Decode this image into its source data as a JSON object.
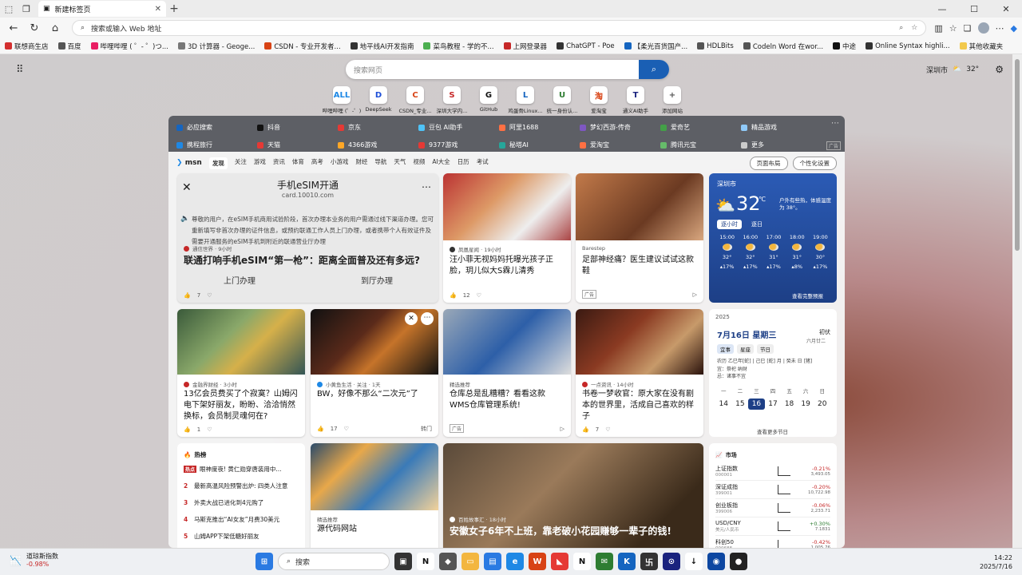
{
  "browser": {
    "tab_title": "新建标签页",
    "address_placeholder": "搜索或输入 Web 地址",
    "bookmarks": [
      {
        "label": "联想商生店",
        "color": "#d32f2f"
      },
      {
        "label": "百度",
        "color": "#555"
      },
      {
        "label": "哔哩哔哩 ( ゜- ゜)つ...",
        "color": "#e91e63"
      },
      {
        "label": "3D 计算器 - Geoge...",
        "color": "#777"
      },
      {
        "label": "CSDN - 专业开发者...",
        "color": "#d84315"
      },
      {
        "label": "地平线AI开发指南",
        "color": "#333"
      },
      {
        "label": "菜鸟教程 - 学的不...",
        "color": "#4caf50"
      },
      {
        "label": "上网登录器",
        "color": "#c62828"
      },
      {
        "label": "ChatGPT - Poe",
        "color": "#333"
      },
      {
        "label": "【柔光百货国产...",
        "color": "#1565c0"
      },
      {
        "label": "HDLBits",
        "color": "#555"
      },
      {
        "label": "Codeln Word 在wor...",
        "color": "#555"
      },
      {
        "label": "中途",
        "color": "#111"
      },
      {
        "label": "Online Syntax highli...",
        "color": "#333"
      },
      {
        "label": "其他收藏夹",
        "color": "#f2c94c"
      }
    ]
  },
  "newtab": {
    "search_placeholder": "搜索网页",
    "weather_city": "深圳市",
    "weather_temp": "32°",
    "quick_links": [
      {
        "label": "哔哩哔哩 (゜-゜)",
        "icon": "ALL",
        "color": "#1e88e5"
      },
      {
        "label": "DeepSeek",
        "icon": "D",
        "color": "#1e4fd8"
      },
      {
        "label": "CSDN_专业...",
        "icon": "C",
        "color": "#d84315"
      },
      {
        "label": "深圳大学内...",
        "icon": "S",
        "color": "#c62828"
      },
      {
        "label": "GitHub",
        "icon": "G",
        "color": "#111"
      },
      {
        "label": "鸡蛋骨Linux...",
        "icon": "L",
        "color": "#1565c0"
      },
      {
        "label": "统一身份认...",
        "icon": "U",
        "color": "#2e7d32"
      },
      {
        "label": "爱淘宝",
        "icon": "淘",
        "color": "#d84315"
      },
      {
        "label": "通义AI助手",
        "icon": "T",
        "color": "#1a237e"
      },
      {
        "label": "添加网站",
        "icon": "+",
        "color": "#555"
      }
    ],
    "top_links": [
      {
        "label": "必应搜索",
        "color": "#1565c0"
      },
      {
        "label": "抖音",
        "color": "#111"
      },
      {
        "label": "京东",
        "color": "#e53935"
      },
      {
        "label": "豆包 AI助手",
        "color": "#4fc3f7"
      },
      {
        "label": "阿里1688",
        "color": "#ff7043"
      },
      {
        "label": "梦幻西游-传奇",
        "color": "#7e57c2"
      },
      {
        "label": "爱奇艺",
        "color": "#43a047"
      },
      {
        "label": "精品游戏",
        "color": "#90caf9"
      },
      {
        "label": "携程旅行",
        "color": "#1e88e5"
      },
      {
        "label": "天猫",
        "color": "#e53935"
      },
      {
        "label": "4366游戏",
        "color": "#ffa726"
      },
      {
        "label": "9377游戏",
        "color": "#e53935"
      },
      {
        "label": "秘塔AI",
        "color": "#26a69a"
      },
      {
        "label": "爱淘宝",
        "color": "#ff7043"
      },
      {
        "label": "腾讯元宝",
        "color": "#66bb6a"
      },
      {
        "label": "更多",
        "color": "#ccc"
      }
    ],
    "ad_label": "广告",
    "msn": {
      "logo": "msn",
      "tabs": [
        "发现",
        "关注",
        "游戏",
        "资讯",
        "体育",
        "高考",
        "小游戏",
        "财经",
        "导航",
        "天气",
        "视频",
        "AI大全",
        "日历",
        "考试"
      ],
      "layout_btn": "页面布局",
      "personalize_btn": "个性化设置"
    },
    "cards": {
      "esim": {
        "title": "手机eSIM开通",
        "host": "card.10010.com",
        "body": "尊敬的用户，在eSIM手机商用试验阶段，首次办理本业务的用户需通过线下渠道办理。您可重新填写非首次办理的证件信息，或预约联通工作人员上门办理，或者携带个人有效证件及需要开通服务的eSIM手机到附近的联通营业厅办理",
        "btn1": "上门办理",
        "btn2": "到厅办理",
        "source": "通信世界 · 9小时",
        "headline": "联通打响手机eSIM“第一枪”：距离全面普及还有多远?",
        "likes": "7"
      },
      "c2": {
        "source": "凤凰星闻 · 19小时",
        "headline": "汪小菲无视妈妈托曝光孩子正脸，玥儿似大S霖儿清秀",
        "likes": "12"
      },
      "c3": {
        "source": "Barestep",
        "headline": "足部神经痛？医生建议试试这款鞋",
        "ad": "广告"
      },
      "c4": {
        "source": "金融界财经 · 3小时",
        "headline": "13亿会员费买了个寂寞？山姆闪电下架好丽友，盼盼、洽洽悄然换标，会员制灵魂何在?",
        "likes": "1"
      },
      "c5": {
        "source": "小黄鱼生活 · 关注 · 1天",
        "headline": "BW，好像不那么“二次元”了",
        "likes": "17",
        "share": "转门"
      },
      "c6": {
        "source": "精选推荐",
        "headline": "仓库总是乱糟糟？看看这款WMS仓库管理系统!",
        "ad": "广告"
      },
      "c7": {
        "source": "一点资讯 · 14小时",
        "headline": "书卷一梦收官：原大家在没有剧本的世界里，活成自己喜欢的样子",
        "likes": "7"
      },
      "c8": {
        "source": "精选推荐",
        "headline": "源代码网站"
      },
      "c9": {
        "source": "百姓故事汇 · 18小时",
        "headline": "安徽女子6年不上班，靠老破小花园赚够一辈子的钱!"
      }
    },
    "weather": {
      "city": "深圳市",
      "temp": "32",
      "unit": "℃",
      "desc": "户外有些热，体感温度为 38°。",
      "tab_hourly": "逐小时",
      "tab_daily": "逐日",
      "hours": [
        {
          "t": "15:00",
          "temp": "32°",
          "rain": "17%"
        },
        {
          "t": "16:00",
          "temp": "32°",
          "rain": "17%"
        },
        {
          "t": "17:00",
          "temp": "31°",
          "rain": "17%"
        },
        {
          "t": "18:00",
          "temp": "31°",
          "rain": "8%"
        },
        {
          "t": "19:00",
          "temp": "30°",
          "rain": "17%"
        }
      ],
      "more": "查看完整预报"
    },
    "calendar": {
      "year": "2025",
      "date": "7月16日 星期三",
      "lunar": "初伏",
      "lunar2": "六月廿二",
      "tabs": [
        "宜事",
        "星座",
        "节日"
      ],
      "yi": "农历 乙巳年[蛇] | 己巳 [蛇] 月 | 癸未 日 [猪]",
      "todo": "宜：祭祀 纳财",
      "avoid": "忌：诸事不宜",
      "weekdays": [
        "一",
        "二",
        "三",
        "四",
        "五",
        "六",
        "日"
      ],
      "dates": [
        "14",
        "15",
        "16",
        "17",
        "18",
        "19",
        "20"
      ],
      "more": "查看更多节日"
    },
    "hot": {
      "title": "热榜",
      "items": [
        {
          "n": "热点",
          "text": "眼神度夜! 黄仁勋穿唐装用中..."
        },
        {
          "n": "2",
          "text": "最新高温风险预警出炉: 四类人注意"
        },
        {
          "n": "3",
          "text": "外卖大战已进化到4元购了"
        },
        {
          "n": "4",
          "text": "马斯克推出“AI女友”月费30美元"
        },
        {
          "n": "5",
          "text": "山姆APP下架低糖好丽友"
        }
      ]
    },
    "market": {
      "title": "市场",
      "rows": [
        {
          "name": "上证指数",
          "code": "000001",
          "chg": "-0.21%",
          "val": "3,493.05",
          "color": "#c62828"
        },
        {
          "name": "深证成指",
          "code": "399001",
          "chg": "-0.20%",
          "val": "10,722.98",
          "color": "#c62828"
        },
        {
          "name": "创业板指",
          "code": "399006",
          "chg": "-0.06%",
          "val": "2,233.71",
          "color": "#c62828"
        },
        {
          "name": "USD/CNY",
          "code": "美元/人民币",
          "chg": "+0.30%",
          "val": "7.1831",
          "color": "#2e7d32"
        },
        {
          "name": "科创50",
          "code": "000688",
          "chg": "-0.42%",
          "val": "1,005.76",
          "color": "#c62828"
        }
      ]
    }
  },
  "taskbar": {
    "stock_name": "道琼斯指数",
    "stock_chg": "-0.98%",
    "search": "搜索",
    "time": "14:22",
    "date": "2025/7/16"
  }
}
